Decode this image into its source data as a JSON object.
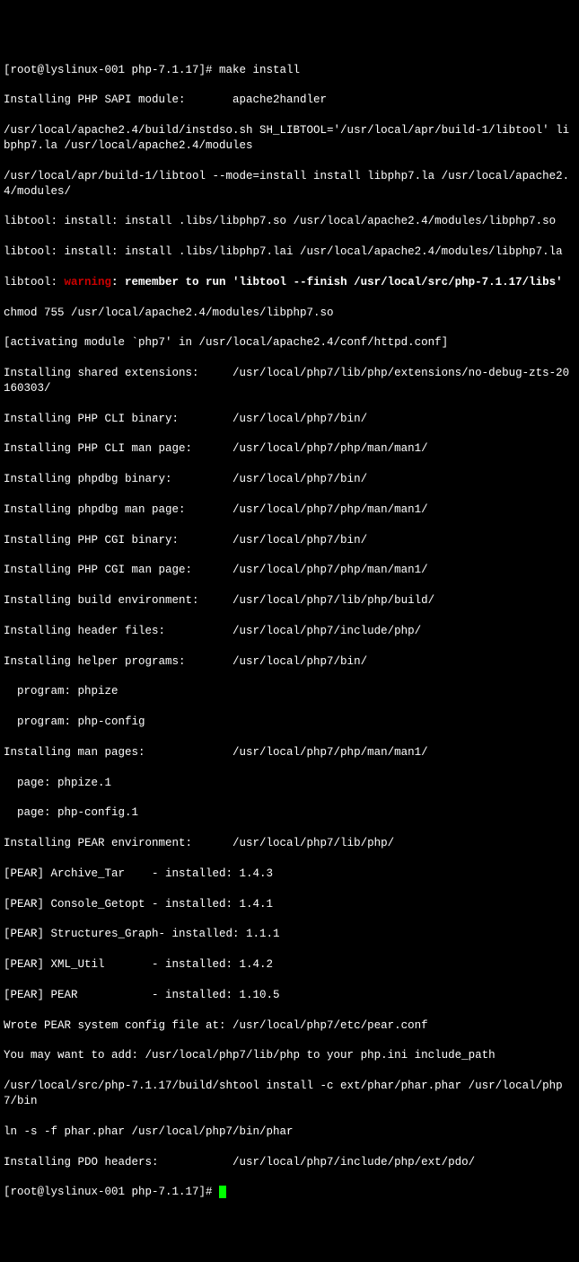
{
  "prompt1": "[root@lyslinux-001 php-7.1.17]# ",
  "cmd1": "make install",
  "lines": [
    "Installing PHP SAPI module:       apache2handler",
    "/usr/local/apache2.4/build/instdso.sh SH_LIBTOOL='/usr/local/apr/build-1/libtool' libphp7.la /usr/local/apache2.4/modules",
    "/usr/local/apr/build-1/libtool --mode=install install libphp7.la /usr/local/apache2.4/modules/",
    "libtool: install: install .libs/libphp7.so /usr/local/apache2.4/modules/libphp7.so",
    "libtool: install: install .libs/libphp7.lai /usr/local/apache2.4/modules/libphp7.la"
  ],
  "warn_prefix": "libtool: ",
  "warn_label": "warning",
  "warn_rest": ": remember to run 'libtool --finish /usr/local/src/php-7.1.17/libs'",
  "lines2": [
    "chmod 755 /usr/local/apache2.4/modules/libphp7.so",
    "[activating module `php7' in /usr/local/apache2.4/conf/httpd.conf]",
    "Installing shared extensions:     /usr/local/php7/lib/php/extensions/no-debug-zts-20160303/",
    "Installing PHP CLI binary:        /usr/local/php7/bin/",
    "Installing PHP CLI man page:      /usr/local/php7/php/man/man1/",
    "Installing phpdbg binary:         /usr/local/php7/bin/",
    "Installing phpdbg man page:       /usr/local/php7/php/man/man1/",
    "Installing PHP CGI binary:        /usr/local/php7/bin/",
    "Installing PHP CGI man page:      /usr/local/php7/php/man/man1/",
    "Installing build environment:     /usr/local/php7/lib/php/build/",
    "Installing header files:          /usr/local/php7/include/php/",
    "Installing helper programs:       /usr/local/php7/bin/",
    "  program: phpize",
    "  program: php-config",
    "Installing man pages:             /usr/local/php7/php/man/man1/",
    "  page: phpize.1",
    "  page: php-config.1",
    "Installing PEAR environment:      /usr/local/php7/lib/php/",
    "[PEAR] Archive_Tar    - installed: 1.4.3",
    "[PEAR] Console_Getopt - installed: 1.4.1",
    "[PEAR] Structures_Graph- installed: 1.1.1",
    "[PEAR] XML_Util       - installed: 1.4.2",
    "[PEAR] PEAR           - installed: 1.10.5",
    "Wrote PEAR system config file at: /usr/local/php7/etc/pear.conf",
    "You may want to add: /usr/local/php7/lib/php to your php.ini include_path",
    "/usr/local/src/php-7.1.17/build/shtool install -c ext/phar/phar.phar /usr/local/php7/bin",
    "ln -s -f phar.phar /usr/local/php7/bin/phar",
    "Installing PDO headers:           /usr/local/php7/include/php/ext/pdo/"
  ],
  "prompt2": "[root@lyslinux-001 php-7.1.17]# "
}
